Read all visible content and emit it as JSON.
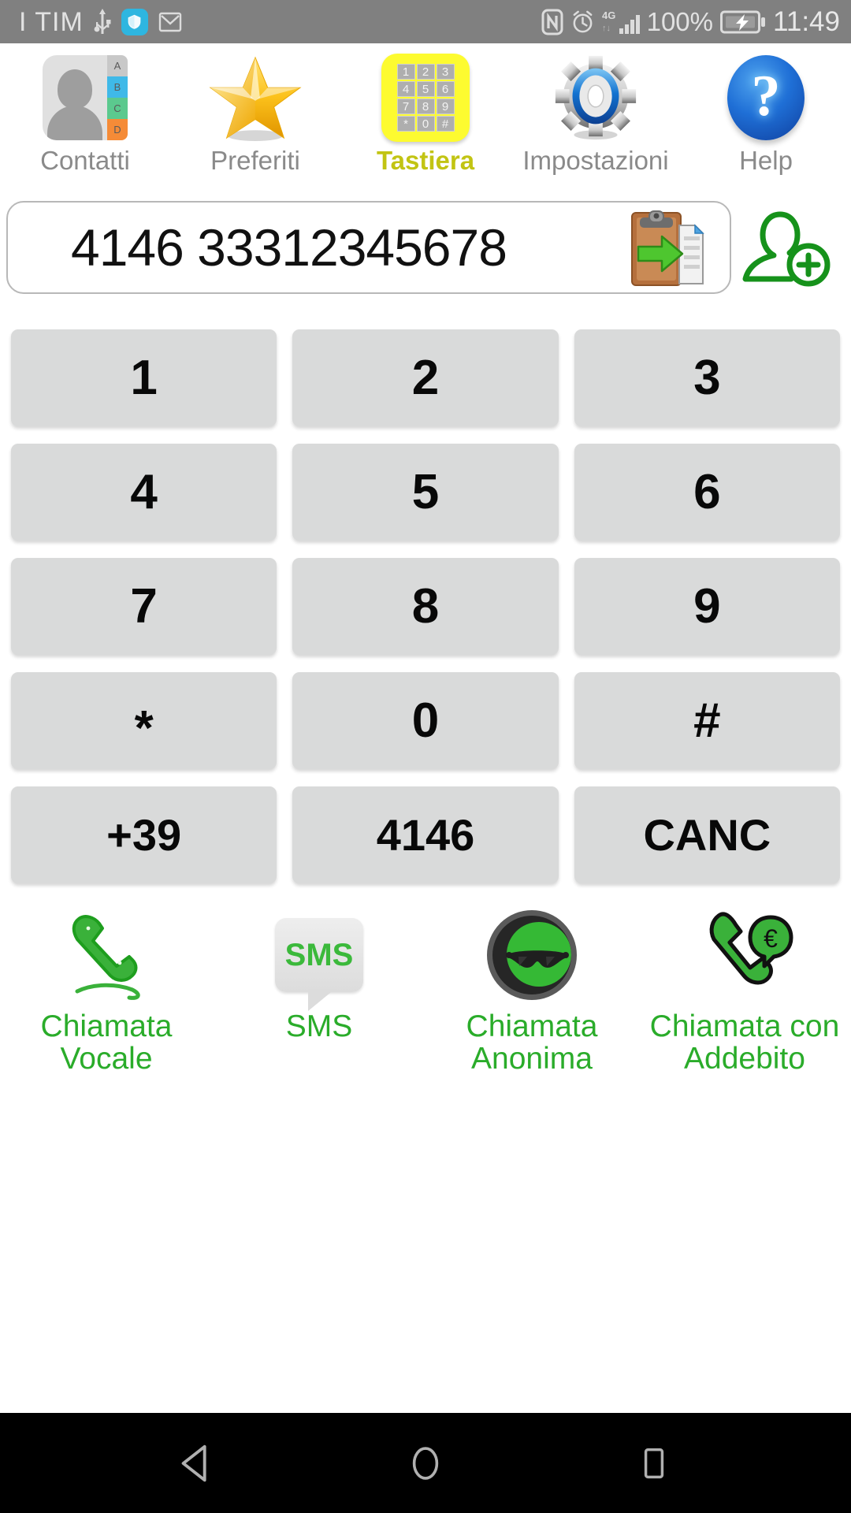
{
  "status_bar": {
    "carrier": "I TIM",
    "battery_percent": "100%",
    "clock": "11:49",
    "network": "4G",
    "icons": [
      "usb-icon",
      "shield-icon",
      "gmail-icon",
      "nfc-icon",
      "alarm-icon",
      "signal-icon",
      "battery-charging-icon"
    ],
    "bg_color": "#808080",
    "text_color": "#e2e2e2"
  },
  "tabs": [
    {
      "label": "Contatti",
      "icon": "contacts-book-icon",
      "active": false
    },
    {
      "label": "Preferiti",
      "icon": "star-icon",
      "active": false
    },
    {
      "label": "Tastiera",
      "icon": "keypad-icon",
      "active": true
    },
    {
      "label": "Impostazioni",
      "icon": "gear-icon",
      "active": false
    },
    {
      "label": "Help",
      "icon": "question-mark-icon",
      "active": false
    }
  ],
  "tab_active_color": "#c2c413",
  "tab_inactive_color": "#8a8a8a",
  "number_field": {
    "value": "4146 33312345678",
    "placeholder": "",
    "paste_icon": "paste-clipboard-icon",
    "add_contact_icon": "add-contact-icon"
  },
  "keypad": {
    "rows": [
      [
        "1",
        "2",
        "3"
      ],
      [
        "4",
        "5",
        "6"
      ],
      [
        "7",
        "8",
        "9"
      ],
      [
        "*",
        "0",
        "#"
      ],
      [
        "+39",
        "4146",
        "CANC"
      ]
    ],
    "key_color": "#d9dada",
    "key_text_color": "#080808"
  },
  "actions": [
    {
      "label": "Chiamata\nVocale",
      "icon": "phone-handset-icon"
    },
    {
      "label": "SMS",
      "icon": "sms-bubble-icon"
    },
    {
      "label": "Chiamata\nAnonima",
      "icon": "anonymous-sunglasses-icon"
    },
    {
      "label": "Chiamata con\nAddebito",
      "icon": "phone-euro-icon"
    }
  ],
  "action_color": "#2aac2a",
  "nav_bar": {
    "buttons": [
      {
        "name": "back",
        "icon": "triangle-back-icon"
      },
      {
        "name": "home",
        "icon": "circle-home-icon"
      },
      {
        "name": "recents",
        "icon": "square-recents-icon"
      }
    ],
    "bg_color": "#000000"
  }
}
